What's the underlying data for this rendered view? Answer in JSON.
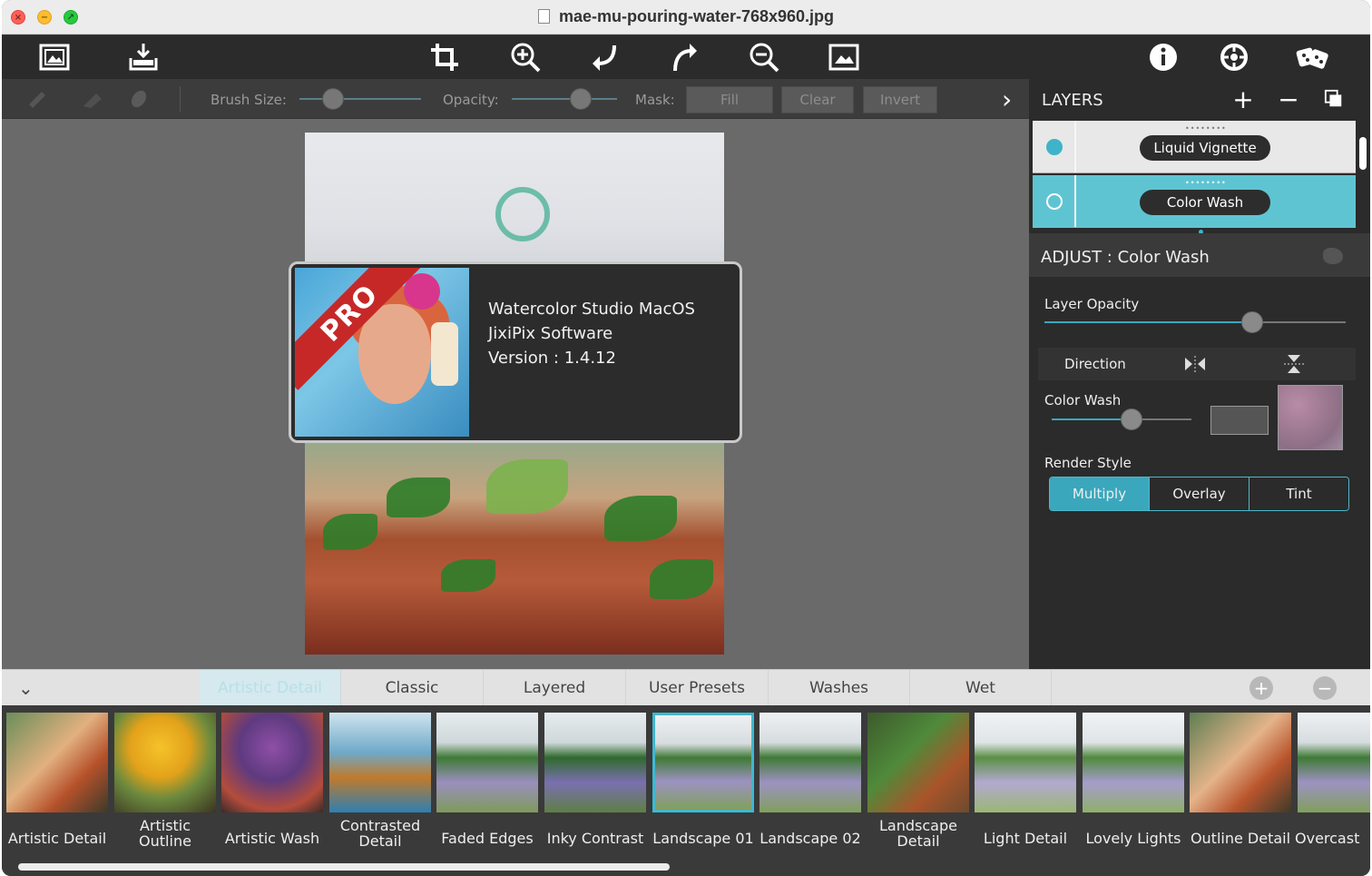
{
  "window": {
    "title": "mae-mu-pouring-water-768x960.jpg"
  },
  "toolbar": {
    "icons": [
      "open-image-icon",
      "save-icon",
      "crop-icon",
      "zoom-in-icon",
      "undo-icon",
      "redo-icon",
      "zoom-out-icon",
      "fit-image-icon",
      "info-icon",
      "settings-icon",
      "random-dice-icon"
    ]
  },
  "brushbar": {
    "brush_size_label": "Brush Size:",
    "opacity_label": "Opacity:",
    "mask_label": "Mask:",
    "fill_label": "Fill",
    "clear_label": "Clear",
    "invert_label": "Invert",
    "expand_glyph": "›"
  },
  "about": {
    "badge": "PRO",
    "line1": "Watercolor Studio MacOS",
    "line2": "JixiPix Software",
    "line3": "Version : 1.4.12"
  },
  "layers": {
    "title": "LAYERS",
    "add_glyph": "+",
    "remove_glyph": "−",
    "items": [
      {
        "label": "Liquid Vignette",
        "visible": true
      },
      {
        "label": "Color Wash",
        "visible": false,
        "selected": true
      }
    ]
  },
  "adjust": {
    "title": "ADJUST : Color Wash",
    "layer_opacity_label": "Layer Opacity",
    "layer_opacity_value": 0.78,
    "direction_label": "Direction",
    "color_wash_label": "Color Wash",
    "color_wash_value": 0.58,
    "render_style_label": "Render Style",
    "render_options": [
      "Multiply",
      "Overlay",
      "Tint"
    ],
    "render_selected": "Multiply"
  },
  "presets": {
    "tabs": [
      "Artistic Detail",
      "Classic",
      "Layered",
      "User Presets",
      "Washes",
      "Wet"
    ],
    "active_tab": "Artistic Detail",
    "add_glyph": "+",
    "remove_glyph": "−",
    "collapse_glyph": "⌄",
    "items": [
      {
        "label": "Artistic Detail"
      },
      {
        "label": "Artistic Outline"
      },
      {
        "label": "Artistic Wash"
      },
      {
        "label": "Contrasted Detail"
      },
      {
        "label": "Faded Edges"
      },
      {
        "label": "Inky Contrast"
      },
      {
        "label": "Landscape 01",
        "selected": true
      },
      {
        "label": "Landscape 02"
      },
      {
        "label": "Landscape Detail"
      },
      {
        "label": "Light Detail"
      },
      {
        "label": "Lovely Lights"
      },
      {
        "label": "Outline Detail"
      },
      {
        "label": "Overcast"
      }
    ]
  },
  "colors": {
    "accent": "#3aa7bd",
    "layer_selected_bg": "#5fc4d2",
    "layer_bg": "#e8e8e8",
    "toolbar_bg": "#2b2b2b",
    "canvas_bg": "#6a6a6a"
  }
}
